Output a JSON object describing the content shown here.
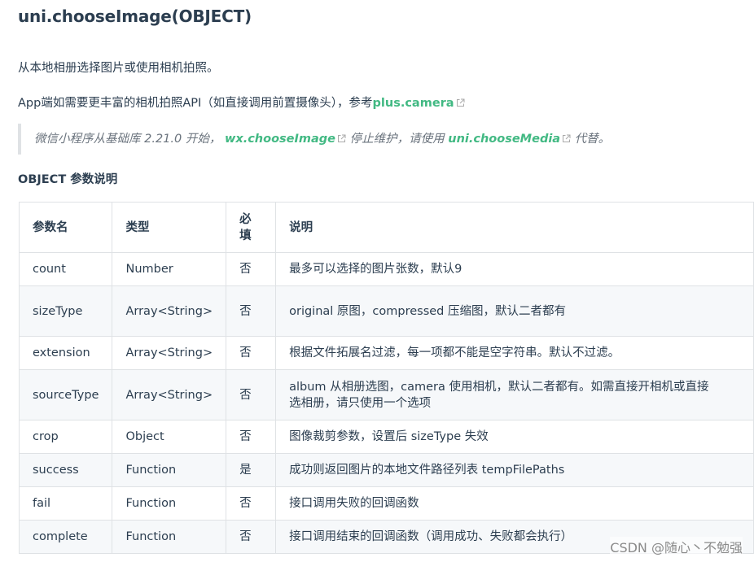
{
  "title": "uni.chooseImage(OBJECT)",
  "intro": "从本地相册选择图片或使用相机拍照。",
  "app_note": {
    "prefix": "App端如需要更丰富的相机拍照API（如直接调用前置摄像头），参考",
    "link": "plus.camera"
  },
  "deprecation_note": {
    "part1": "微信小程序从基础库 2.21.0 开始，",
    "link1": "wx.chooseImage",
    "part2": "停止维护，请使用",
    "link2": "uni.chooseMedia",
    "part3": "代替。"
  },
  "section_title": "OBJECT 参数说明",
  "table": {
    "headers": {
      "name": "参数名",
      "type": "类型",
      "required_line1": "必",
      "required_line2": "填",
      "desc": "说明"
    },
    "rows": [
      {
        "name": "count",
        "type": "Number",
        "required": "否",
        "desc": "最多可以选择的图片张数，默认9"
      },
      {
        "name": "sizeType",
        "type": "Array<String>",
        "required": "否",
        "desc": "original 原图，compressed 压缩图，默认二者都有"
      },
      {
        "name": "extension",
        "type": "Array<String>",
        "required": "否",
        "desc": "根据文件拓展名过滤，每一项都不能是空字符串。默认不过滤。"
      },
      {
        "name": "sourceType",
        "type": "Array<String>",
        "required": "否",
        "desc_line1": "album 从相册选图，camera 使用相机，默认二者都有。如需直接开相机或直接",
        "desc_line2": "选相册，请只使用一个选项"
      },
      {
        "name": "crop",
        "type": "Object",
        "required": "否",
        "desc": "图像裁剪参数，设置后 sizeType 失效"
      },
      {
        "name": "success",
        "type": "Function",
        "required": "是",
        "desc": "成功则返回图片的本地文件路径列表 tempFilePaths"
      },
      {
        "name": "fail",
        "type": "Function",
        "required": "否",
        "desc": "接口调用失败的回调函数"
      },
      {
        "name": "complete",
        "type": "Function",
        "required": "否",
        "desc": "接口调用结束的回调函数（调用成功、失败都会执行）"
      }
    ]
  },
  "watermark": "CSDN @随心丶不勉强",
  "colors": {
    "link": "#42b983",
    "text": "#2c3e50",
    "note_text": "#6a737d",
    "border": "#dfe2e5",
    "stripe": "#f6f8fa"
  },
  "icons": [
    "external-link-icon"
  ]
}
